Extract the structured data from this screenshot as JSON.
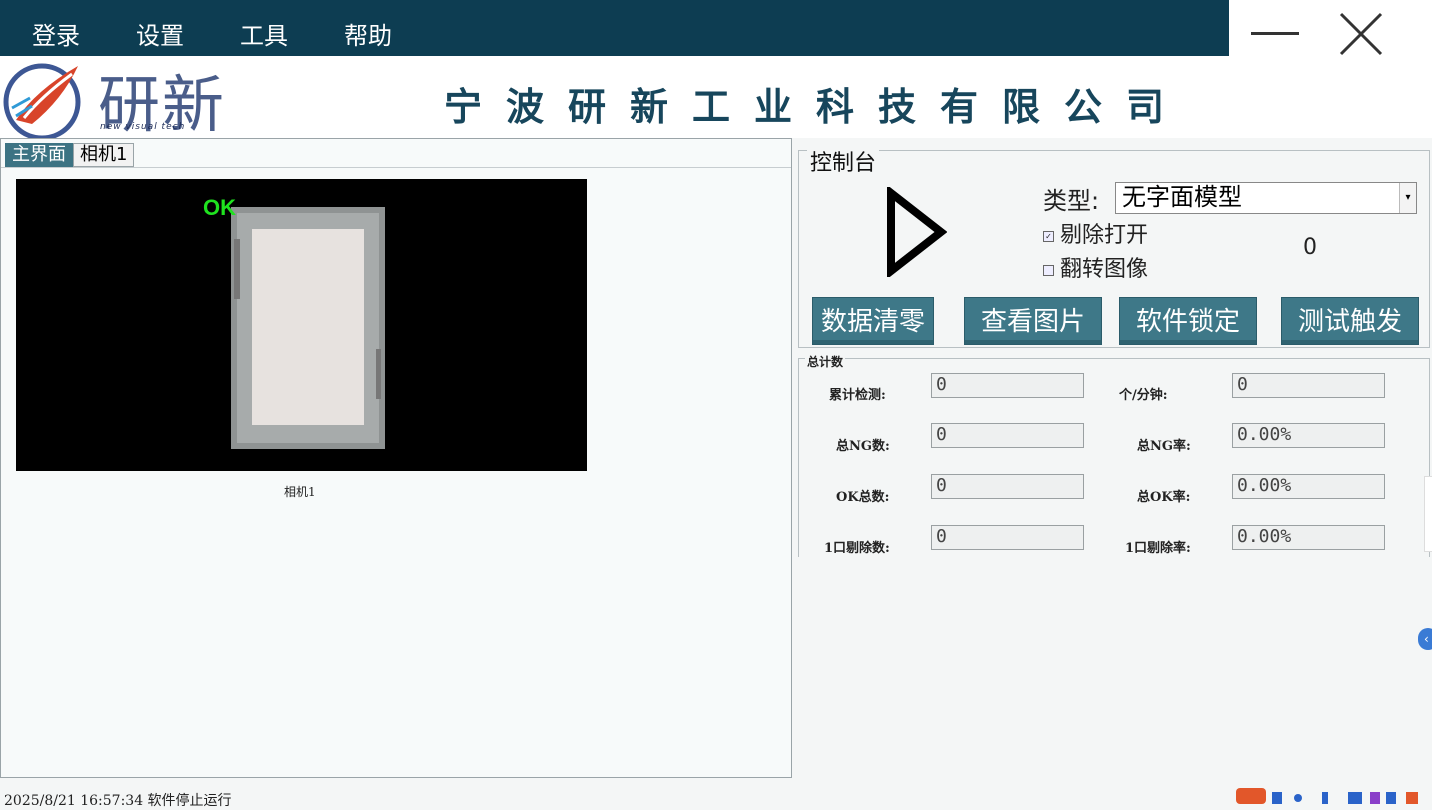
{
  "menu": {
    "items": [
      "登录",
      "设置",
      "工具",
      "帮助"
    ]
  },
  "header": {
    "logo_text": "研新",
    "logo_sub": "new visual tech",
    "company_name": "宁波研新工业科技有限公司"
  },
  "left": {
    "tabs": [
      "主界面",
      "相机1"
    ],
    "ok_label": "OK",
    "camera_caption": "相机1"
  },
  "control": {
    "title": "控制台",
    "type_label": "类型:",
    "type_value": "无字面模型",
    "check_reject": "剔除打开",
    "check_reject_checked": true,
    "check_flip": "翻转图像",
    "check_flip_checked": false,
    "counter": "0",
    "buttons": [
      "数据清零",
      "查看图片",
      "软件锁定",
      "测试触发"
    ]
  },
  "stats": {
    "title": "总计数",
    "items": [
      {
        "label": "累计检测:",
        "value": "0"
      },
      {
        "label": "个/分钟:",
        "value": "0"
      },
      {
        "label": "总NG数:",
        "value": "0"
      },
      {
        "label": "总NG率:",
        "value": "0.00%"
      },
      {
        "label": "OK总数:",
        "value": "0"
      },
      {
        "label": "总OK率:",
        "value": "0.00%"
      },
      {
        "label": "1口剔除数:",
        "value": "0"
      },
      {
        "label": "1口剔除率:",
        "value": "0.00%"
      }
    ]
  },
  "status": {
    "text": "2025/8/21 16:57:34 软件停止运行"
  },
  "colors": {
    "menubar": "#0d3d52",
    "button": "#3e7888",
    "ok": "#1fe21f"
  }
}
